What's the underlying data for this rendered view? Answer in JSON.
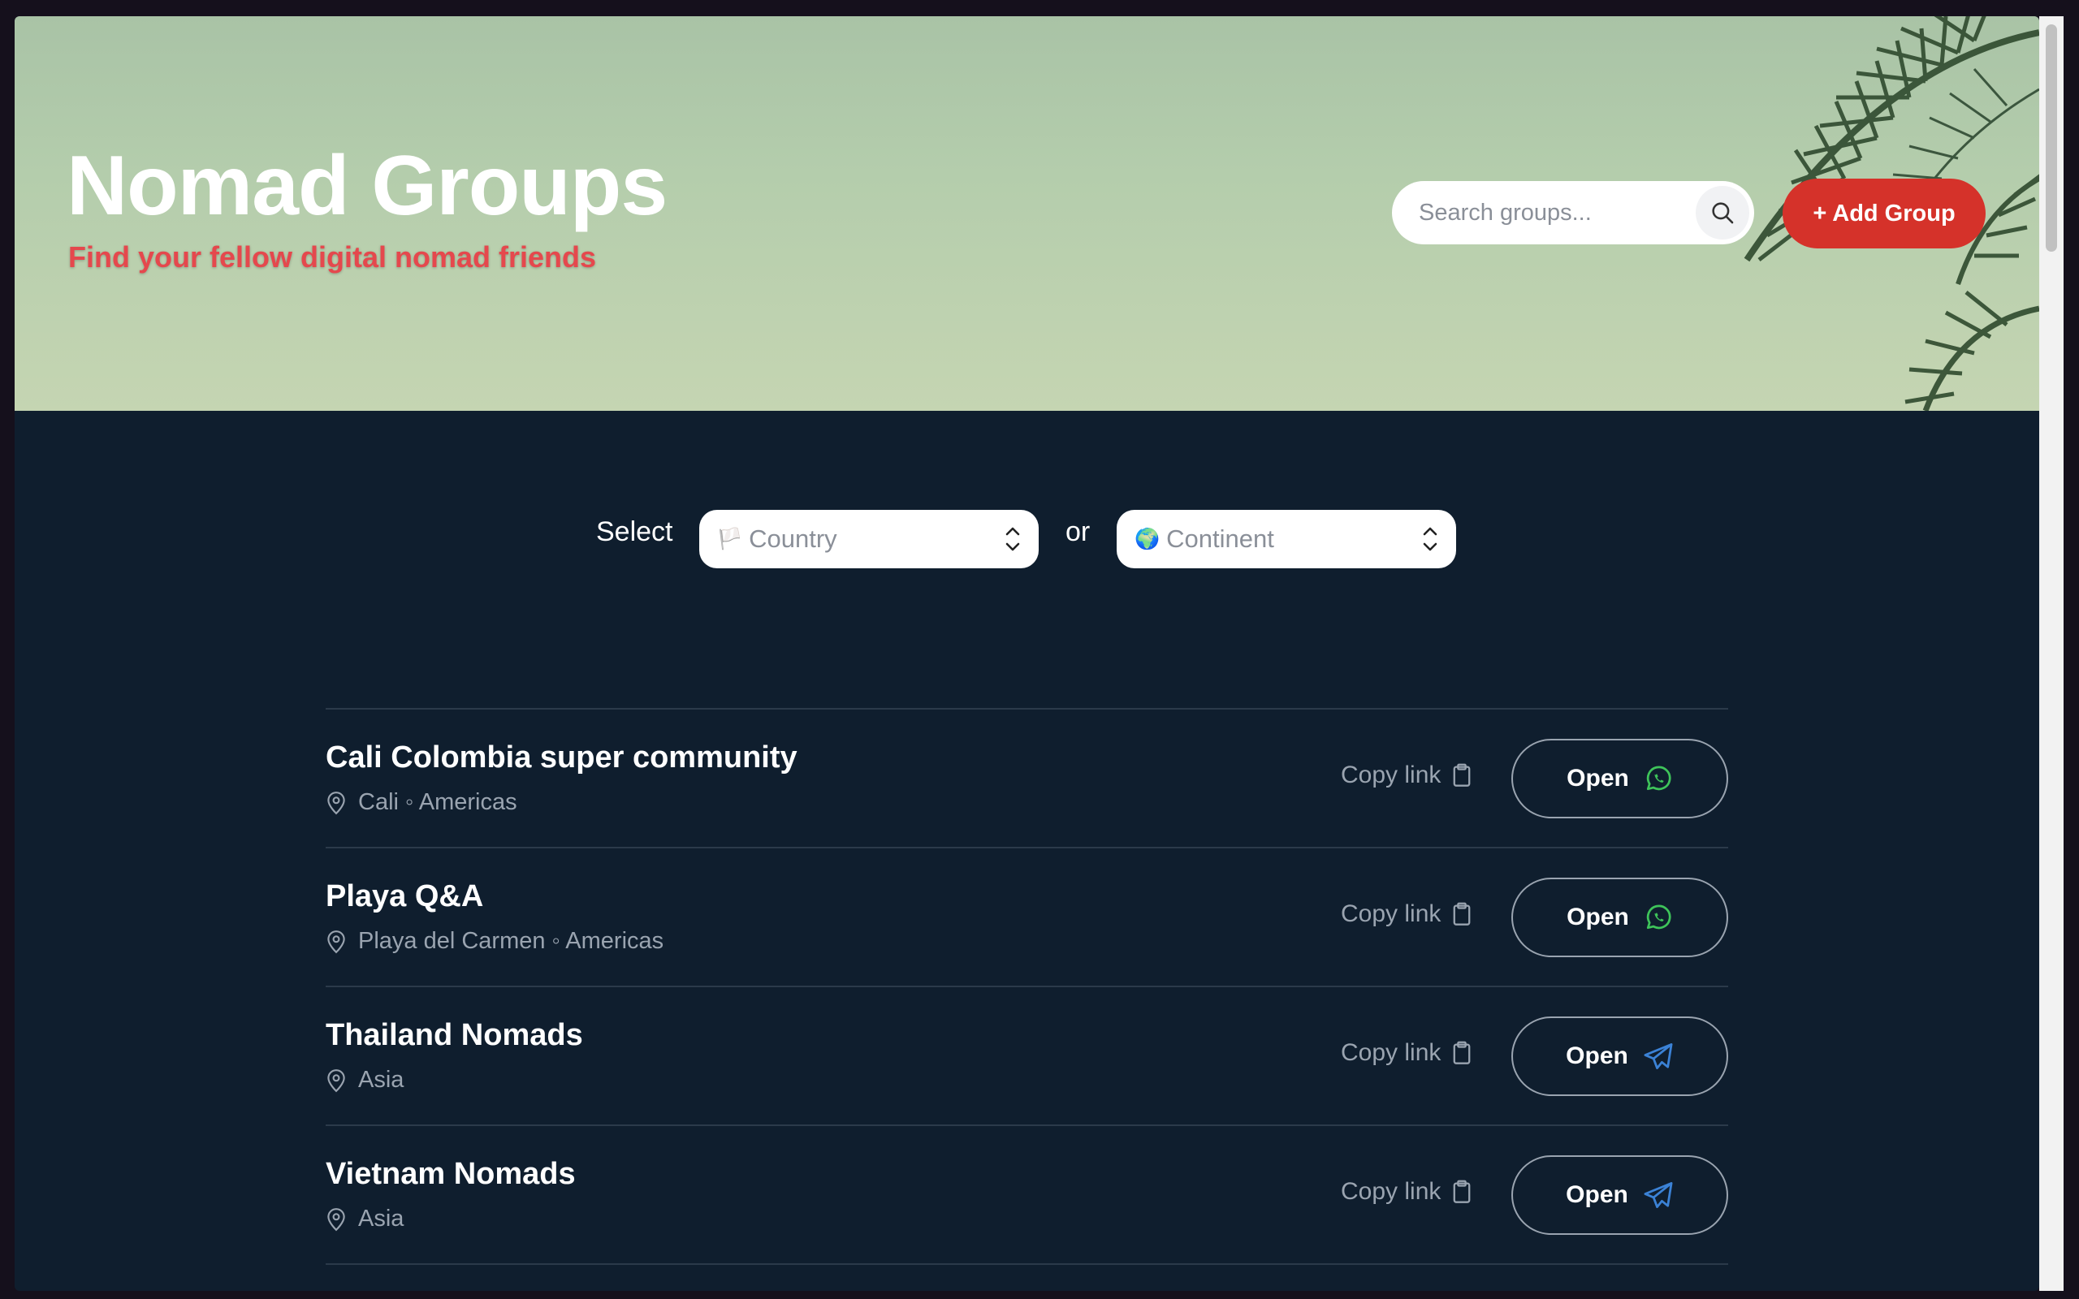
{
  "header": {
    "title": "Nomad Groups",
    "subtitle": "Find your fellow digital nomad friends"
  },
  "search": {
    "placeholder": "Search groups..."
  },
  "add_button": "+ Add Group",
  "filter": {
    "select_label": "Select",
    "or_label": "or",
    "country": {
      "emoji": "🏳️",
      "placeholder": "Country"
    },
    "continent": {
      "emoji": "🌍",
      "placeholder": "Continent"
    }
  },
  "groups": [
    {
      "name": "Cali Colombia super community",
      "location": "Cali ◦ Americas",
      "copy_label": "Copy link",
      "open_label": "Open",
      "platform_icon": "whatsapp-icon"
    },
    {
      "name": "Playa Q&A",
      "location": "Playa del Carmen ◦ Americas",
      "copy_label": "Copy link",
      "open_label": "Open",
      "platform_icon": "whatsapp-icon"
    },
    {
      "name": "Thailand Nomads",
      "location": "Asia",
      "copy_label": "Copy link",
      "open_label": "Open",
      "platform_icon": "telegram-icon"
    },
    {
      "name": "Vietnam Nomads",
      "location": "Asia",
      "copy_label": "Copy link",
      "open_label": "Open",
      "platform_icon": "telegram-icon"
    }
  ],
  "colors": {
    "accent": "#d5322a",
    "subtitle": "#e5484d",
    "background": "#0f1e2e",
    "whatsapp": "#3ec45a",
    "telegram": "#3b82d6"
  }
}
